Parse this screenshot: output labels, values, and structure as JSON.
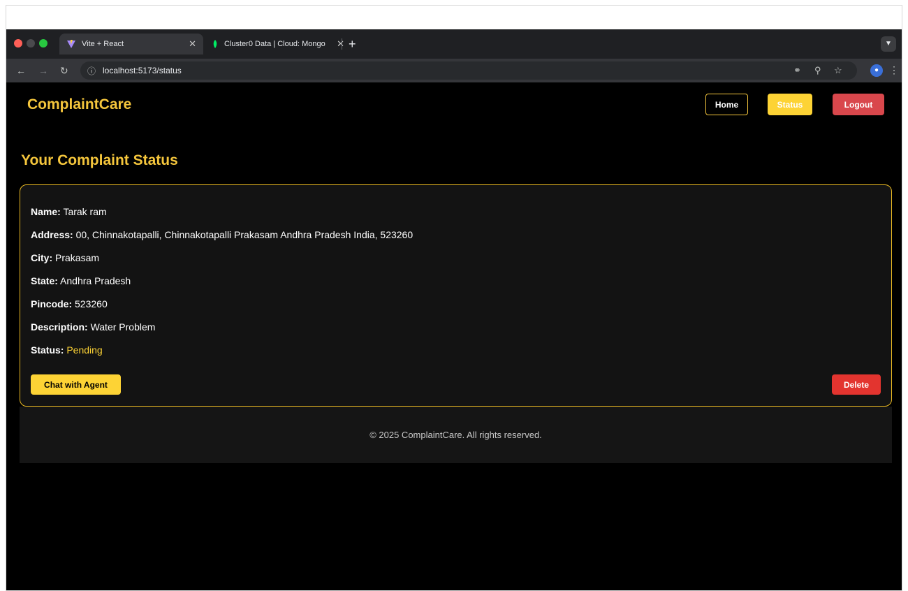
{
  "browser": {
    "tabs": [
      {
        "title": "Vite + React",
        "close": "✕"
      },
      {
        "title": "Cluster0 Data | Cloud: Mongo",
        "close": "✕"
      }
    ],
    "new_tab": "+",
    "url": "localhost:5173/status",
    "colors": {
      "close": "#ff5f57",
      "minimize": "#febc2e",
      "maximize": "#28c840"
    }
  },
  "header": {
    "brand": "ComplaintCare",
    "nav": {
      "home": "Home",
      "status": "Status",
      "logout": "Logout"
    }
  },
  "main": {
    "heading": "Your Complaint Status",
    "complaint": {
      "name_label": "Name:",
      "name": "Tarak ram",
      "address_label": "Address:",
      "address": "00, Chinnakotapalli, Chinnakotapalli Prakasam Andhra Pradesh India, 523260",
      "city_label": "City:",
      "city": "Prakasam",
      "state_label": "State:",
      "state": "Andhra Pradesh",
      "pincode_label": "Pincode:",
      "pincode": "523260",
      "description_label": "Description:",
      "description": "Water Problem",
      "status_label": "Status:",
      "status": "Pending"
    },
    "chat_button": "Chat with Agent",
    "delete_button": "Delete"
  },
  "footer": {
    "text": "© 2025 ComplaintCare. All rights reserved."
  },
  "theme": {
    "accent": "#fdd335",
    "danger": "#e3342f",
    "logout": "#d9474c"
  }
}
